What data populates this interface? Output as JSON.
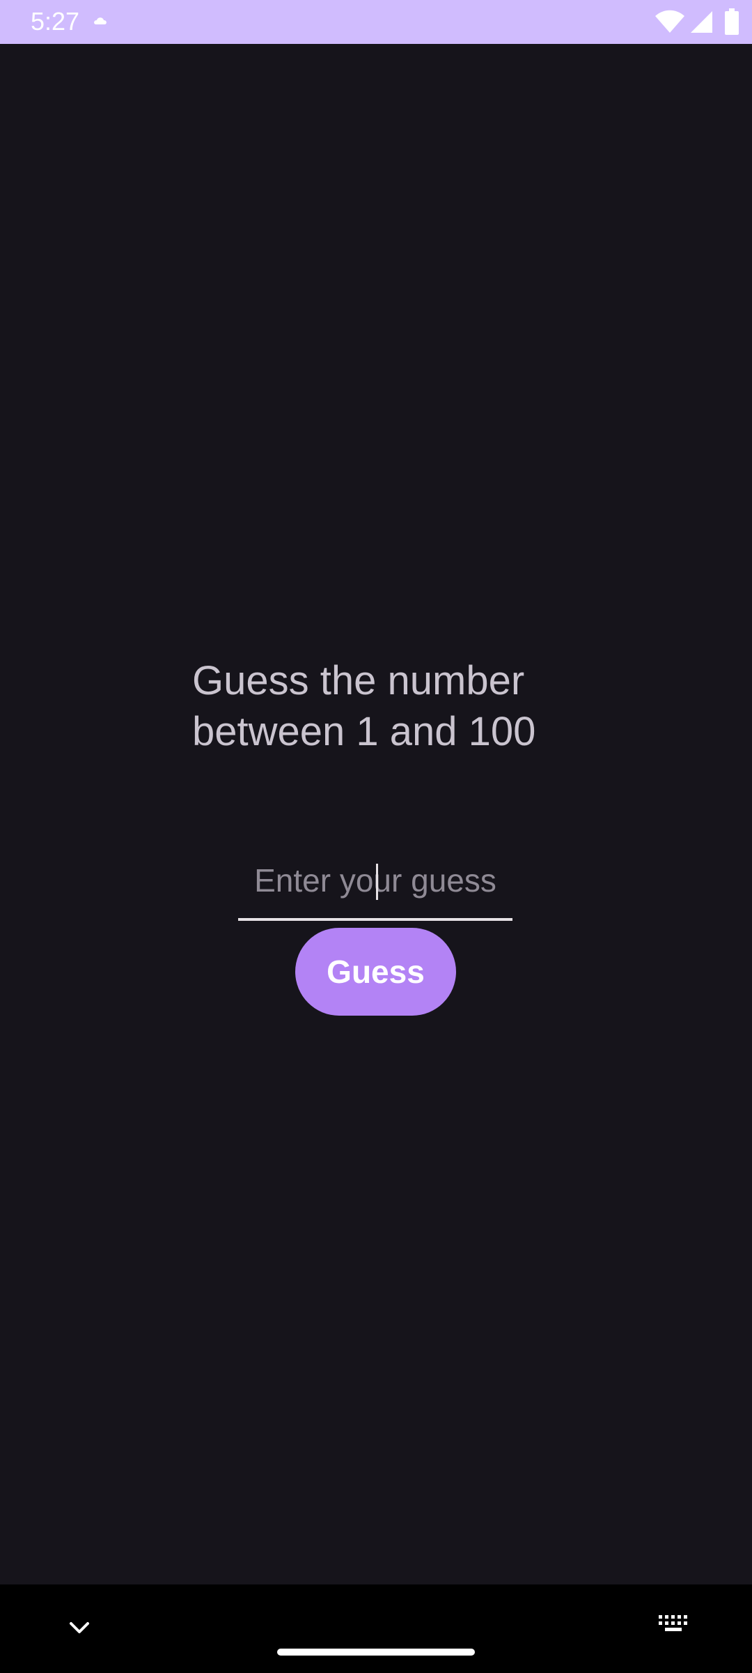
{
  "status_bar": {
    "time": "5:27",
    "icons": [
      "cloud-icon",
      "wifi-icon",
      "signal-icon",
      "battery-icon"
    ],
    "background": "#d0bcfe"
  },
  "game": {
    "prompt": "Guess the number\nbetween 1 and 100",
    "input_placeholder": "Enter your guess",
    "input_value": "",
    "button_label": "Guess"
  },
  "colors": {
    "background": "#16141b",
    "accent": "#b383f5",
    "text": "#cac4cf"
  },
  "nav_bar": {
    "icons": [
      "chevron-down-icon",
      "home-handle",
      "keyboard-icon"
    ]
  }
}
